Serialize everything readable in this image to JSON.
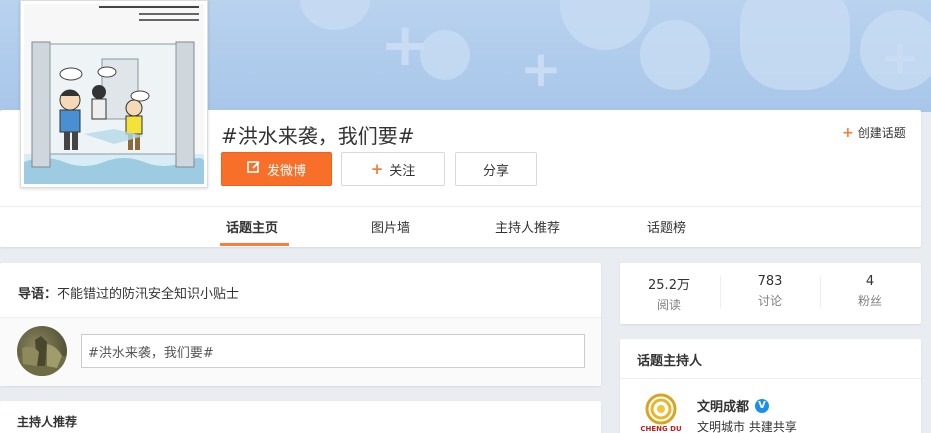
{
  "topic": {
    "title": "#洪水来袭，我们要#",
    "create_label": "创建话题"
  },
  "actions": {
    "post_label": "发微博",
    "follow_label": "关注",
    "share_label": "分享"
  },
  "tabs": [
    {
      "label": "话题主页",
      "active": true
    },
    {
      "label": "图片墙",
      "active": false
    },
    {
      "label": "主持人推荐",
      "active": false
    },
    {
      "label": "话题榜",
      "active": false
    }
  ],
  "lead": {
    "prefix": "导语：",
    "text": "不能错过的防汛安全知识小贴士"
  },
  "composer": {
    "value": "#洪水来袭，我们要#"
  },
  "hosts_section": {
    "title": "主持人推荐"
  },
  "stats": [
    {
      "value": "25.2万",
      "label": "阅读"
    },
    {
      "value": "783",
      "label": "讨论"
    },
    {
      "value": "4",
      "label": "粉丝"
    }
  ],
  "host": {
    "section_title": "话题主持人",
    "name": "文明成都",
    "description": "文明城市 共建共享",
    "logo_text": "CHENG DU"
  },
  "colors": {
    "accent": "#f76f29",
    "verified": "#1a8ff0",
    "banner": "#a8c6ea"
  },
  "icons": {
    "post": "edit-icon",
    "follow": "plus-icon",
    "create": "plus-icon",
    "verified": "verified-v-icon"
  }
}
